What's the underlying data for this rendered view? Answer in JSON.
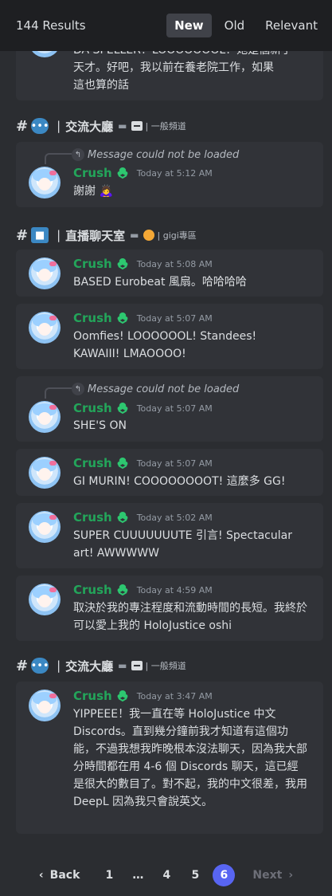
{
  "header": {
    "results": "144 Results",
    "tabs": [
      {
        "label": "New",
        "active": true
      },
      {
        "label": "Old",
        "active": false
      },
      {
        "label": "Relevant",
        "active": false
      }
    ]
  },
  "top_partial": {
    "line1": "DA SPELLER！LOOOOOOOL！她是個新手",
    "line2": "天才。好吧，我以前在養老院工作，如果",
    "line3": "這也算的話"
  },
  "channels": [
    {
      "hash": "#",
      "icon": "speech-balloon-icon",
      "sep": "|",
      "name": "交流大廳",
      "sub": "一般頻道"
    },
    {
      "hash": "#",
      "icon": "video-camera-icon",
      "sep": "|",
      "name": "直播聊天室",
      "sub": "gigi專區"
    },
    {
      "hash": "#",
      "icon": "speech-balloon-icon",
      "sep": "|",
      "name": "交流大廳",
      "sub": "一般頻道"
    }
  ],
  "messages": [
    {
      "user": "Crush",
      "time": "Today at 5:12 AM",
      "reply": "Message could not be loaded",
      "text": "謝謝 🙇‍♀️"
    },
    {
      "user": "Crush",
      "time": "Today at 5:08 AM",
      "text": "BASED Eurobeat 風扇。哈哈哈哈"
    },
    {
      "user": "Crush",
      "time": "Today at 5:07 AM",
      "text": "Oomfies! LOOOOOOL! Standees! KAWAIII! LMAOOOO!"
    },
    {
      "user": "Crush",
      "time": "Today at 5:07 AM",
      "reply": "Message could not be loaded",
      "text": "SHE'S ON"
    },
    {
      "user": "Crush",
      "time": "Today at 5:07 AM",
      "text": "GI MURIN! COOOOOOOOT! 這麼多 GG!"
    },
    {
      "user": "Crush",
      "time": "Today at 5:02 AM",
      "text": "SUPER CUUUUUUUTE 引言! Spectacular art! AWWWWW"
    },
    {
      "user": "Crush",
      "time": "Today at 4:59 AM",
      "text": "取決於我的專注程度和流動時間的長短。我終於可以愛上我的 HoloJustice oshi"
    },
    {
      "user": "Crush",
      "time": "Today at 3:47 AM",
      "text": "YIPPEEE！我一直在等 HoloJustice 中文 Discords。直到幾分鐘前我才知道有這個功能，不過我想我昨晚根本沒法聊天，因為我大部分時間都在用 4-6 個 Discords 聊天，這已經是很大的數目了。對不起，我的中文很差，我用 DeepL 因為我只會說英文。"
    }
  ],
  "pagination": {
    "back": "Back",
    "pages": [
      "1",
      "…",
      "4",
      "5",
      "6"
    ],
    "current": "6",
    "next": "Next"
  },
  "colors": {
    "username": "#23a55a",
    "accent": "#5865f2",
    "background": "#2b2d31",
    "card": "#313338"
  }
}
